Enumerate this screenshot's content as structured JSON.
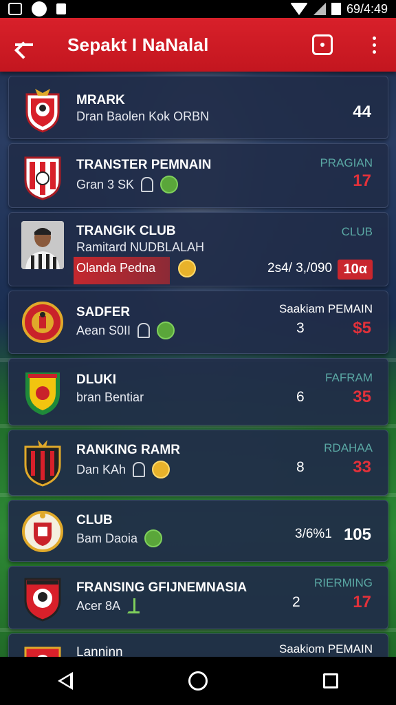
{
  "status_bar": {
    "time": "69/4:49",
    "icons": [
      "gallery-icon",
      "notification-circle-icon",
      "lock-icon",
      "wifi-icon",
      "signal-icon",
      "battery-icon"
    ]
  },
  "app_bar": {
    "title": "Sepakt I NaNalal",
    "back_icon": "arrow-left-icon",
    "action_icon": "square-action-icon",
    "menu_icon": "more-vertical-icon"
  },
  "colors": {
    "app_bar": "#d8202a",
    "row_bg": "#202c48",
    "accent_teal": "#5aa8a4",
    "score_red": "#e2313a"
  },
  "rows": [
    {
      "title": "MRARK",
      "subtitle": "Dran Baolen Kok ORBN",
      "label": "",
      "count": "",
      "score": "44"
    },
    {
      "title": "TRANSTER PEMNAIN",
      "subtitle": "Gran 3 SK",
      "label": "PRAGIAN",
      "count": "",
      "score": "17"
    },
    {
      "title": "TRANGIK CLUB",
      "subtitle": "Ramitard NUDBLALAH",
      "label": "CLUB",
      "band_text": "Olanda Pedna",
      "mid_text": "2s4/ 3,/090",
      "score": "10α"
    },
    {
      "title": "SADFER",
      "subtitle": "Aean S0II",
      "label": "Saakiam PEMAIN",
      "count": "3",
      "score": "$5"
    },
    {
      "title": "DLUKI",
      "subtitle": "bran Bentiar",
      "label": "FAFRAM",
      "count": "6",
      "score": "35"
    },
    {
      "title": "RANKING RAMR",
      "subtitle": "Dan KAh",
      "label": "RDAHAA",
      "count": "8",
      "score": "33"
    },
    {
      "title": "CLUB",
      "subtitle": "Bam Daoia",
      "label": "",
      "count": "3/6%1",
      "score": "105"
    },
    {
      "title": "FRANSING GFIJNEMNASIA",
      "subtitle": "Acer 8A",
      "label": "RIERMING",
      "count": "2",
      "score": "17"
    },
    {
      "title": "Lanninn",
      "subtitle": "",
      "label": "Saakiom PEMAIN",
      "count": "",
      "score": ""
    }
  ],
  "nav_bar": {
    "back_icon": "nav-back-icon",
    "home_icon": "nav-home-icon",
    "recents_icon": "nav-recents-icon"
  }
}
